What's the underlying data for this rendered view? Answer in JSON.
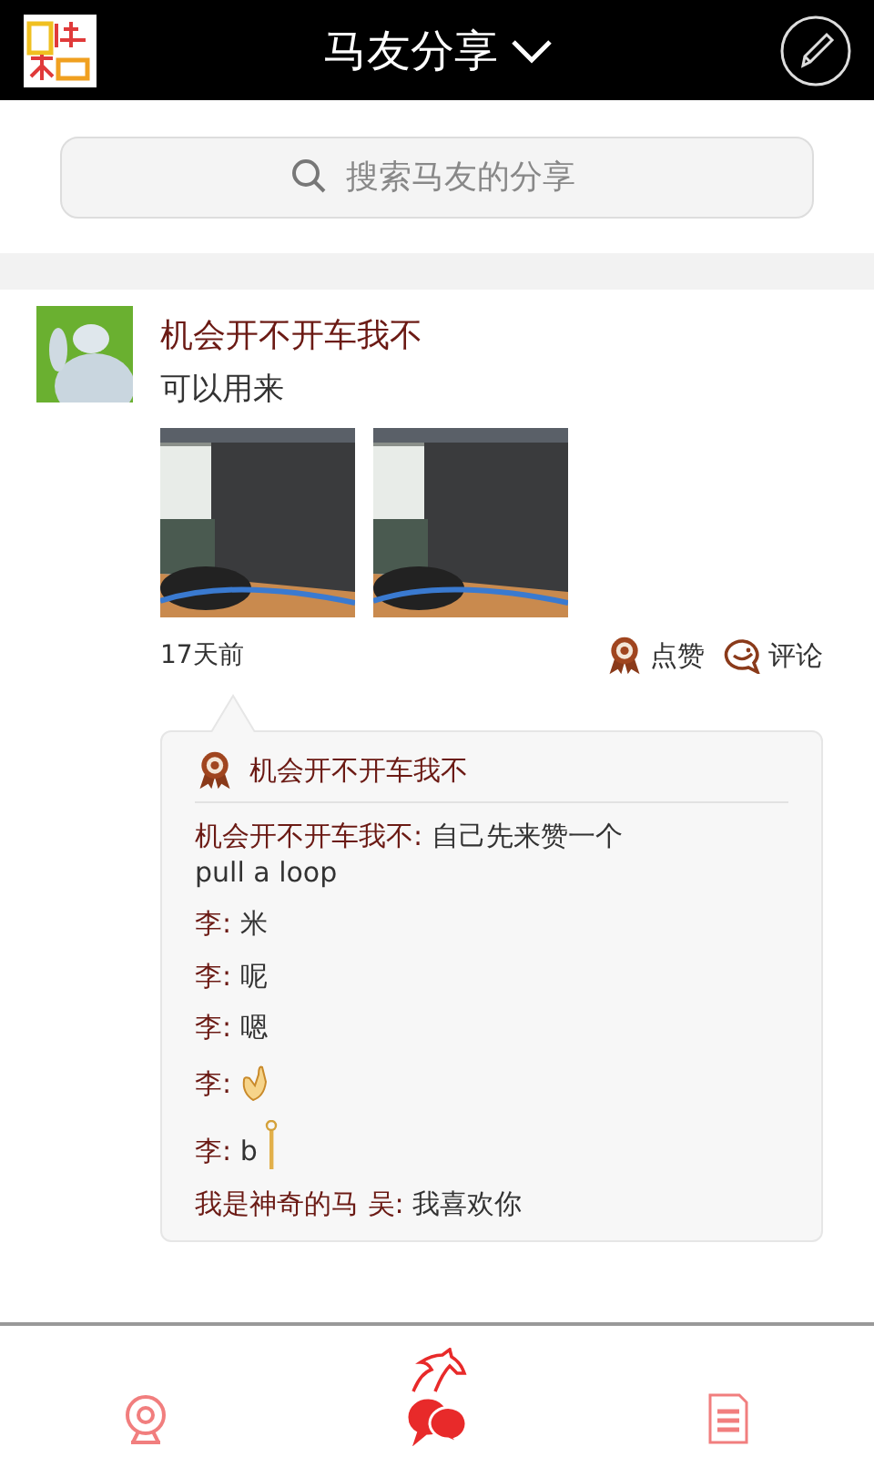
{
  "header": {
    "title": "马友分享"
  },
  "search": {
    "placeholder": "搜索马友的分享"
  },
  "post": {
    "author": "机会开不开车我不",
    "text": "可以用来",
    "time": "17天前",
    "actions": [
      {
        "kind": "like",
        "label": "点赞"
      },
      {
        "kind": "comment",
        "label": "评论"
      }
    ],
    "likes": {
      "names": "机会开不开车我不"
    },
    "comments": [
      {
        "kind": "text",
        "author": "机会开不开车我不:",
        "text": "自己先来赞一个\npull a loop"
      },
      {
        "kind": "text",
        "author": "李:",
        "text": "米"
      },
      {
        "kind": "text",
        "author": "李:",
        "text": "呢"
      },
      {
        "kind": "text",
        "author": "李:",
        "text": "嗯"
      },
      {
        "kind": "hand",
        "author": "李:"
      },
      {
        "kind": "pin",
        "author": "李:",
        "text": "b"
      },
      {
        "kind": "text",
        "author": "我是神奇的马 吴:",
        "text": "我喜欢你"
      }
    ]
  },
  "tabs": [
    {
      "kind": "camera",
      "selected": false
    },
    {
      "kind": "chat",
      "selected": true
    },
    {
      "kind": "list",
      "selected": false
    }
  ]
}
